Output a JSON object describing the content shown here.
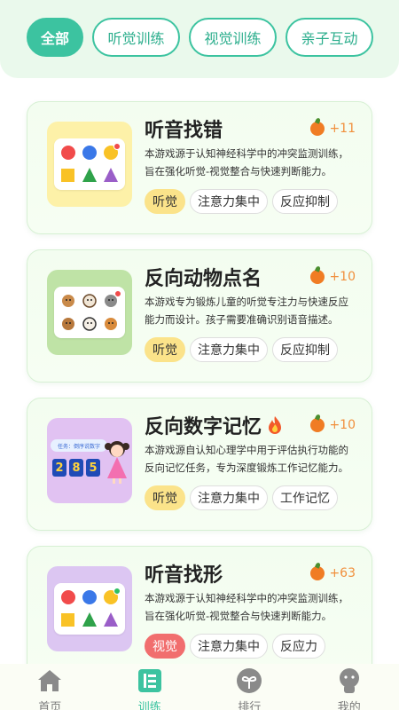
{
  "filters": [
    {
      "label": "全部",
      "active": true
    },
    {
      "label": "听觉训练",
      "active": false
    },
    {
      "label": "视觉训练",
      "active": false
    },
    {
      "label": "亲子互动",
      "active": false
    }
  ],
  "cards": [
    {
      "title": "听音找错",
      "score": "+11",
      "desc": "本游戏源于认知神经科学中的冲突监测训练，旨在强化听觉-视觉整合与快速判断能力。",
      "tags": [
        "听觉",
        "注意力集中",
        "反应抑制"
      ]
    },
    {
      "title": "反向动物点名",
      "score": "+10",
      "desc": "本游戏专为锻炼儿童的听觉专注力与快速反应能力而设计。孩子需要准确识别语音描述。",
      "tags": [
        "听觉",
        "注意力集中",
        "反应抑制"
      ]
    },
    {
      "title": "反向数字记忆",
      "score": "+10",
      "desc": "本游戏源自认知心理学中用于评估执行功能的反向记忆任务，专为深度锻炼工作记忆能力。",
      "tags": [
        "听觉",
        "注意力集中",
        "工作记忆"
      ],
      "thumb_text": {
        "banner": "任务：倒序说数字",
        "digits": [
          "2",
          "8",
          "5"
        ]
      }
    },
    {
      "title": "听音找形",
      "score": "+63",
      "desc": "本游戏源于认知神经科学中的冲突监测训练，旨在强化听觉-视觉整合与快速判断能力。",
      "tags": [
        "视觉",
        "注意力集中",
        "反应力"
      ]
    }
  ],
  "nav": [
    {
      "label": "首页",
      "icon": "home-icon",
      "active": false
    },
    {
      "label": "训练",
      "icon": "training-icon",
      "active": true
    },
    {
      "label": "排行",
      "icon": "ranking-icon",
      "active": false
    },
    {
      "label": "我的",
      "icon": "profile-icon",
      "active": false
    }
  ],
  "colors": {
    "accent": "#3cc3a0",
    "score": "#f18f3c",
    "audio_tag": "#fbe38a",
    "visual_tag": "#f16e6e"
  }
}
